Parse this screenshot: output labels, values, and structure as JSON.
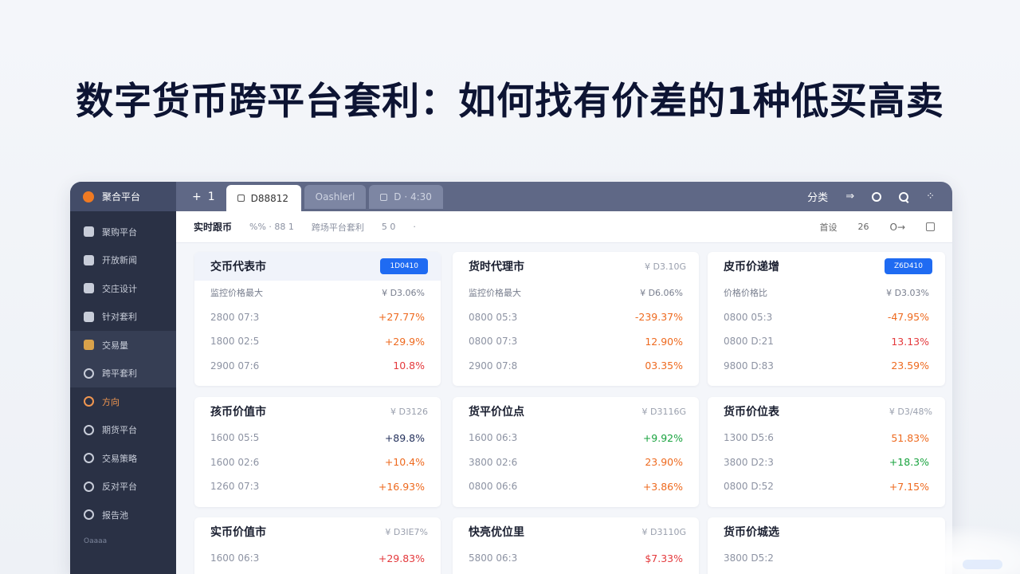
{
  "headline": "数字货币跨平台套利：如何找有价差的1种低买高卖",
  "topbar": {
    "brand": "聚合平台",
    "add_tab": "+",
    "add_tab_count": "1",
    "tabs": [
      {
        "label": "D88812",
        "active": true
      },
      {
        "label": "Oashlerl",
        "active": false
      },
      {
        "label": "D · 4:30",
        "active": false
      }
    ],
    "right": {
      "label": "分类",
      "arrow": "⇒",
      "grid": "⁘"
    }
  },
  "sidebar": {
    "items": [
      {
        "label": "聚购平台",
        "icon": "square",
        "highlight": false
      },
      {
        "label": "开放新闻",
        "icon": "square",
        "highlight": false
      },
      {
        "label": "交庄设计",
        "icon": "square",
        "highlight": false
      },
      {
        "label": "针对套利",
        "icon": "square",
        "highlight": false
      },
      {
        "label": "交易量",
        "icon": "gold",
        "highlight": true
      },
      {
        "label": "跨平套利",
        "icon": "ring",
        "highlight": true
      },
      {
        "label": "方向",
        "icon": "orange",
        "highlight": false
      },
      {
        "label": "期货平台",
        "icon": "ring",
        "highlight": false
      },
      {
        "label": "交易策略",
        "icon": "ring",
        "highlight": false
      },
      {
        "label": "反对平台",
        "icon": "ring",
        "highlight": false
      },
      {
        "label": "报告池",
        "icon": "ring",
        "highlight": false
      }
    ],
    "group_label": "Oaaaa"
  },
  "subbar": {
    "title": "实时跟币",
    "items": [
      "%% · 88 1",
      "跨场平台套利",
      "5 0",
      "·"
    ],
    "right": {
      "label": "首设",
      "num": "26",
      "key": "O→"
    }
  },
  "cards": [
    {
      "title": "交币代表市",
      "badge": "1D0410",
      "tint": true,
      "sub": {
        "label": "监控价格最大",
        "value": "¥ D3.06%"
      },
      "rows": [
        {
          "label": "2800  07:3",
          "value": "+27.77%",
          "color": "orange"
        },
        {
          "label": "1800  02:5",
          "value": "+29.9%",
          "color": "orange"
        },
        {
          "label": "2900  07:6",
          "value": "10.8%",
          "color": "red"
        }
      ]
    },
    {
      "title": "货时代理市",
      "price": "¥ D3.10G",
      "tint": false,
      "sub": {
        "label": "监控价格最大",
        "value": "¥ D6.06%"
      },
      "rows": [
        {
          "label": "0800  05:3",
          "value": "-239.37%",
          "color": "orange"
        },
        {
          "label": "0800  07:3",
          "value": "12.90%",
          "color": "orange"
        },
        {
          "label": "2900  07:8",
          "value": "03.35%",
          "color": "orange"
        }
      ]
    },
    {
      "title": "皮币价递增",
      "badge": "Z6D410",
      "tint": false,
      "sub": {
        "label": "价格价格比",
        "value": "¥ D3.03%"
      },
      "rows": [
        {
          "label": "0800  05:3",
          "value": "-47.95%",
          "color": "orange"
        },
        {
          "label": "0800  D:21",
          "value": "13.13%",
          "color": "red"
        },
        {
          "label": "9800  D:83",
          "value": "23.59%",
          "color": "orange"
        }
      ]
    },
    {
      "title": "孩币价值市",
      "price": "¥ D3126",
      "tint": false,
      "rows": [
        {
          "label": "1600  05:5",
          "value": "+89.8%",
          "color": "navy"
        },
        {
          "label": "1600  02:6",
          "value": "+10.4%",
          "color": "orange"
        },
        {
          "label": "1260  07:3",
          "value": "+16.93%",
          "color": "orange"
        }
      ]
    },
    {
      "title": "货平价位点",
      "price": "¥ D3116G",
      "tint": false,
      "rows": [
        {
          "label": "1600  06:3",
          "value": "+9.92%",
          "color": "green"
        },
        {
          "label": "3800  02:6",
          "value": "23.90%",
          "color": "orange"
        },
        {
          "label": "0800  06:6",
          "value": "+3.86%",
          "color": "orange"
        }
      ]
    },
    {
      "title": "货币价位表",
      "price": "¥ D3/48%",
      "tint": false,
      "rows": [
        {
          "label": "1300  D5:6",
          "value": "51.83%",
          "color": "orange"
        },
        {
          "label": "3800  D2:3",
          "value": "+18.3%",
          "color": "green"
        },
        {
          "label": "0800  D:52",
          "value": "+7.15%",
          "color": "orange"
        }
      ]
    },
    {
      "title": "实币价值市",
      "price": "¥ D3IE7%",
      "tint": false,
      "rows": [
        {
          "label": "1600  06:3",
          "value": "+29.83%",
          "color": "red"
        }
      ]
    },
    {
      "title": "快亮优位里",
      "price": "¥ D3110G",
      "tint": false,
      "rows": [
        {
          "label": "5800  06:3",
          "value": "$7.33%",
          "color": "red"
        }
      ]
    },
    {
      "title": "货币价城选",
      "price": "",
      "tint": false,
      "rows": [
        {
          "label": "3800  D5:2",
          "value": "",
          "color": "gray"
        }
      ]
    }
  ]
}
